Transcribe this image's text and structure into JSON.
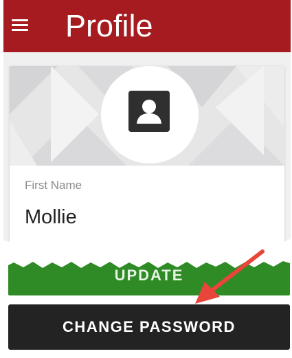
{
  "header": {
    "title": "Profile",
    "menu_icon": "hamburger-menu-icon",
    "background_color": "#a51b1f"
  },
  "profile": {
    "avatar_icon": "user-avatar-icon",
    "first_name_label": "First Name",
    "first_name_value": "Mollie"
  },
  "buttons": {
    "update_label": "UPDATE",
    "update_color": "#2e8b25",
    "change_password_label": "CHANGE PASSWORD",
    "change_password_color": "#232323"
  },
  "annotation": {
    "arrow_color": "#e8453c",
    "arrow_icon": "red-arrow-icon"
  }
}
